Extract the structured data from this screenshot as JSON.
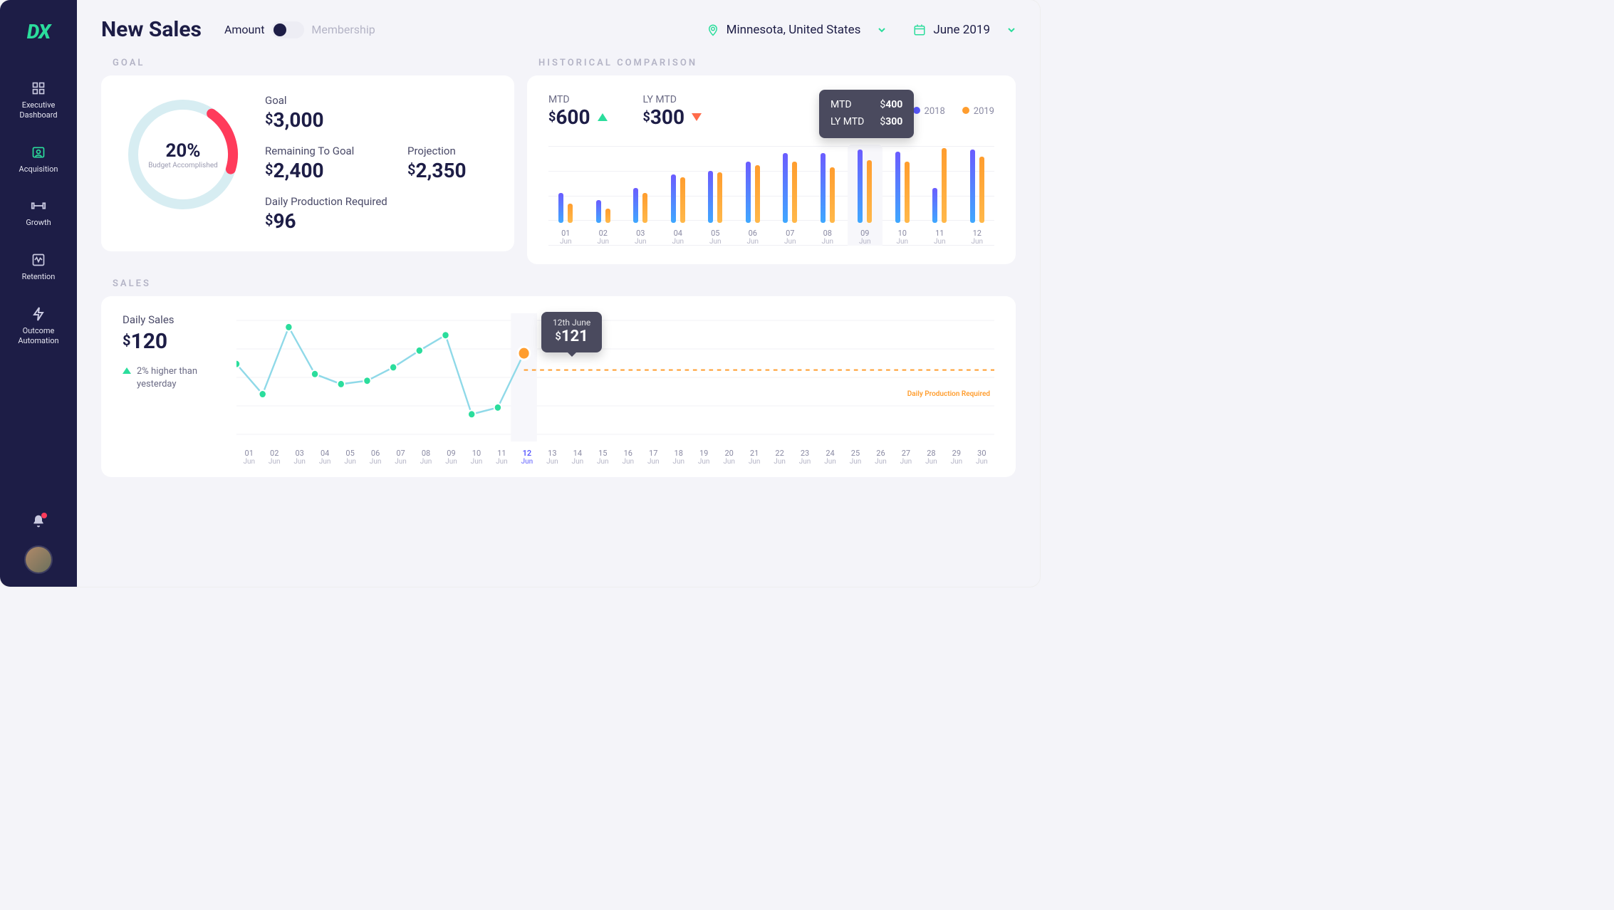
{
  "brand": "DX",
  "nav": [
    {
      "label": "Executive Dashboard",
      "icon": "grid"
    },
    {
      "label": "Acquisition",
      "icon": "user-plus"
    },
    {
      "label": "Growth",
      "icon": "dumbbell"
    },
    {
      "label": "Retention",
      "icon": "activity"
    },
    {
      "label": "Outcome Automation",
      "icon": "bolt"
    }
  ],
  "header": {
    "title": "New Sales",
    "toggle": {
      "left": "Amount",
      "right": "Membership",
      "value": "Amount"
    },
    "location": "Minnesota, United States",
    "period": "June 2019"
  },
  "sections": {
    "goal": "GOAL",
    "historical": "HISTORICAL COMPARISON",
    "sales": "SALES"
  },
  "goal": {
    "percent": "20%",
    "percent_value": 20,
    "percent_label": "Budget Accomplished",
    "goal_label": "Goal",
    "goal_value": "3,000",
    "remaining_label": "Remaining To Goal",
    "remaining_value": "2,400",
    "projection_label": "Projection",
    "projection_value": "2,350",
    "daily_label": "Daily Production Required",
    "daily_value": "96"
  },
  "historical": {
    "mtd_label": "MTD",
    "mtd_value": "600",
    "mtd_trend": "up",
    "lymtd_label": "LY MTD",
    "lymtd_value": "300",
    "lymtd_trend": "down",
    "legend": [
      {
        "label": "2018",
        "color": "#5A5AFF"
      },
      {
        "label": "2019",
        "color": "#FF9D2E"
      }
    ],
    "tooltip": {
      "row1_label": "MTD",
      "row1_value": "400",
      "row2_label": "LY MTD",
      "row2_value": "300"
    },
    "highlight_index": 8
  },
  "sales": {
    "daily_label": "Daily Sales",
    "daily_value": "120",
    "delta_text": "2% higher than yesterday",
    "tooltip": {
      "date": "12th June",
      "value": "121"
    },
    "dpr_label": "Daily Production Required",
    "highlight_index": 11
  },
  "chart_data": {
    "historical_bars": {
      "type": "bar",
      "categories": [
        "01",
        "02",
        "03",
        "04",
        "05",
        "06",
        "07",
        "08",
        "09",
        "10",
        "11",
        "12"
      ],
      "month": "Jun",
      "series": [
        {
          "name": "2018",
          "values": [
            170,
            130,
            200,
            280,
            300,
            350,
            400,
            400,
            420,
            410,
            200,
            420
          ]
        },
        {
          "name": "2019",
          "values": [
            110,
            80,
            170,
            260,
            290,
            330,
            350,
            320,
            360,
            350,
            430,
            380
          ]
        }
      ],
      "ylim": [
        0,
        450
      ]
    },
    "sales_line": {
      "type": "line",
      "x": [
        "01",
        "02",
        "03",
        "04",
        "05",
        "06",
        "07",
        "08",
        "09",
        "10",
        "11",
        "12",
        "13",
        "14",
        "15",
        "16",
        "17",
        "18",
        "19",
        "20",
        "21",
        "22",
        "23",
        "24",
        "25",
        "26",
        "27",
        "28",
        "29",
        "30"
      ],
      "month": "Jun",
      "series": [
        {
          "name": "Daily Sales",
          "values": [
            105,
            60,
            160,
            90,
            75,
            80,
            100,
            125,
            148,
            30,
            40,
            121
          ]
        }
      ],
      "reference_line": 96,
      "ylim": [
        0,
        170
      ]
    }
  },
  "colors": {
    "accent": "#2BDD9C",
    "brand_dark": "#1D1D46",
    "orange": "#FF9D2E",
    "purple": "#5A5AFF"
  }
}
